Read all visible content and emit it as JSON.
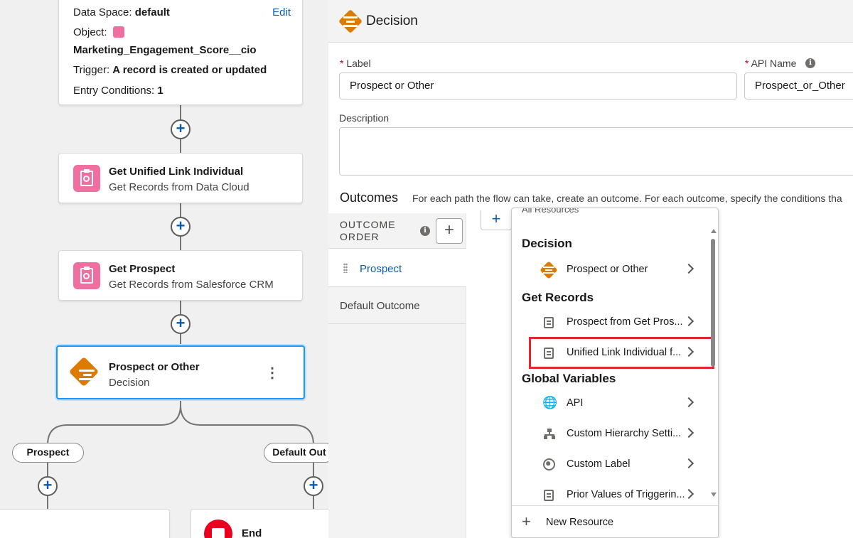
{
  "canvas": {
    "start_card": {
      "data_space_label": "Data Space:",
      "data_space_value": "default",
      "edit_link": "Edit",
      "object_label": "Object:",
      "object_value": "Marketing_Engagement_Score__cio",
      "trigger_label": "Trigger:",
      "trigger_value": "A record is created or updated",
      "entry_label": "Entry Conditions:",
      "entry_value": "1"
    },
    "nodes": [
      {
        "title": "Get Unified Link Individual",
        "subtitle": "Get Records from Data Cloud"
      },
      {
        "title": "Get Prospect",
        "subtitle": "Get Records from Salesforce CRM"
      },
      {
        "title": "Prospect or Other",
        "subtitle": "Decision"
      }
    ],
    "branches": [
      "Prospect",
      "Default Out"
    ],
    "end_label": "End",
    "add_glyph": "+",
    "menu_glyph": "⋮"
  },
  "panel": {
    "title": "Decision",
    "label_field": {
      "label": "Label",
      "value": "Prospect or Other"
    },
    "api_field": {
      "label": "API Name",
      "value": "Prospect_or_Other"
    },
    "description_label": "Description",
    "outcomes_title": "Outcomes",
    "outcomes_help": "For each path the flow can take, create an outcome. For each outcome, specify the conditions tha",
    "outcome_order_line1": "OUTCOME",
    "outcome_order_line2": "ORDER",
    "outcomes": [
      "Prospect",
      "Default Outcome"
    ],
    "info_glyph": "i",
    "required_mark": "*"
  },
  "dropdown": {
    "partial_top_text": "All Resources",
    "sections": [
      {
        "heading": "Decision",
        "items": [
          {
            "label": "Prospect or Other",
            "icon": "decision-icon"
          }
        ]
      },
      {
        "heading": "Get Records",
        "items": [
          {
            "label": "Prospect from Get Pros...",
            "icon": "record-icon"
          },
          {
            "label": "Unified Link Individual f...",
            "icon": "record-icon",
            "highlighted": true
          }
        ]
      },
      {
        "heading": "Global Variables",
        "items": [
          {
            "label": "API",
            "icon": "api-globe-icon"
          },
          {
            "label": "Custom Hierarchy Setti...",
            "icon": "hierarchy-icon"
          },
          {
            "label": "Custom Label",
            "icon": "globe-icon"
          },
          {
            "label": "Prior Values of Triggerin...",
            "icon": "record-icon"
          }
        ]
      }
    ],
    "new_resource": "New Resource"
  },
  "colors": {
    "accent_blue": "#0b5cab",
    "decision_orange": "#dd7a01",
    "get_records_pink": "#f16fa0",
    "highlight_red": "#e3262f",
    "end_red": "#ea001e"
  }
}
